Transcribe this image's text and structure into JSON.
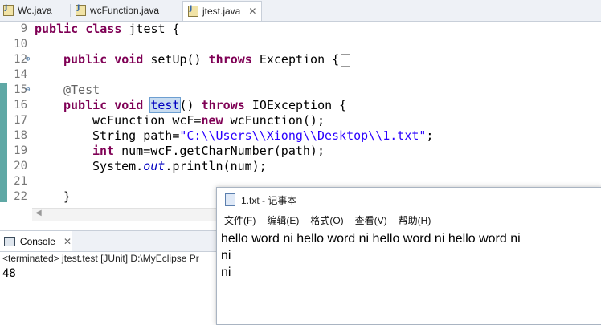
{
  "tabs": [
    {
      "label": "Wc.java",
      "close": ""
    },
    {
      "label": "wcFunction.java",
      "close": ""
    },
    {
      "label": "jtest.java",
      "close": "✕"
    }
  ],
  "lines": [
    {
      "num": "9"
    },
    {
      "num": "10"
    },
    {
      "num": "12"
    },
    {
      "num": "14"
    },
    {
      "num": "15"
    },
    {
      "num": "16"
    },
    {
      "num": "17"
    },
    {
      "num": "18"
    },
    {
      "num": "19"
    },
    {
      "num": "20"
    },
    {
      "num": "21"
    },
    {
      "num": "22"
    }
  ],
  "code": {
    "l9_kw": "public class",
    "l9_rest": " jtest {",
    "l12_kw1": "public void",
    "l12_mid": " setUp() ",
    "l12_kw2": "throws",
    "l12_rest": " Exception {",
    "l15_ann": "@Test",
    "l16_kw1": "public void",
    "l16_sel": "test",
    "l16_mid": "() ",
    "l16_kw2": "throws",
    "l16_rest": " IOException {",
    "l17_a": "wcFunction wcF=",
    "l17_kw": "new",
    "l17_b": " wcFunction();",
    "l18_a": "String path=",
    "l18_str": "\"C:\\\\Users\\\\Xiong\\\\Desktop\\\\1.txt\"",
    "l18_b": ";",
    "l19_kw": "int",
    "l19_rest": " num=wcF.getCharNumber(path);",
    "l20_a": "System.",
    "l20_it": "out",
    "l20_b": ".println(num);",
    "l22": "}"
  },
  "console": {
    "tab_label": "Console",
    "close": "✕",
    "terminated": "<terminated> jtest.test [JUnit] D:\\MyEclipse Pr",
    "output": "48"
  },
  "notepad": {
    "title": "1.txt - 记事本",
    "menu": [
      "文件(F)",
      "编辑(E)",
      "格式(O)",
      "查看(V)",
      "帮助(H)"
    ],
    "text_lines": [
      "hello word ni hello word ni hello word ni hello word ni",
      "ni",
      "ni"
    ]
  }
}
